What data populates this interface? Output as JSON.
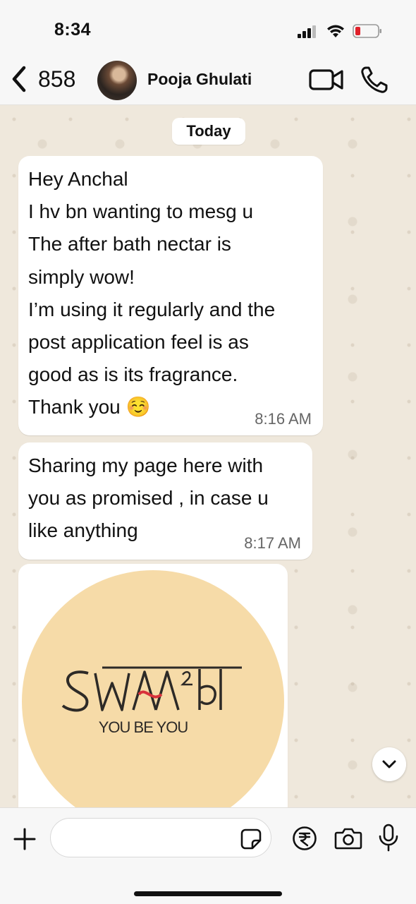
{
  "status_bar": {
    "time": "8:34"
  },
  "header": {
    "back_count": "858",
    "contact_name": "Pooja Ghulati",
    "icons": [
      "back-chevron-icon",
      "video-call-icon",
      "phone-call-icon"
    ]
  },
  "chat": {
    "day_label": "Today",
    "messages": [
      {
        "lines": [
          "Hey Anchal",
          "I hv bn wanting to mesg u",
          "The after bath nectar is",
          "simply wow!",
          "I’m using it regularly and the",
          "post application feel is as",
          "good as is its fragrance.",
          "Thank you ☺️"
        ],
        "time": "8:16 AM"
      },
      {
        "lines": [
          "Sharing my page here with",
          "you as promised , in case u",
          "like anything"
        ],
        "time": "8:17 AM"
      }
    ],
    "image_message": {
      "logo_text": "SWAA²d",
      "logo_tagline": "YOU BE YOU"
    }
  },
  "composer": {
    "input_value": "",
    "input_placeholder": "",
    "icons": [
      "plus-icon",
      "sticker-icon",
      "rupee-payment-icon",
      "camera-icon",
      "microphone-icon"
    ]
  },
  "colors": {
    "background": "#efe8dc",
    "bubble": "#ffffff",
    "logo_circle": "#f6dba8",
    "logo_accent": "#d8313b"
  }
}
